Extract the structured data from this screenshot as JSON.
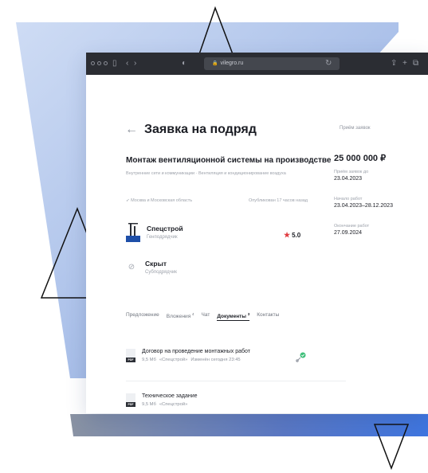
{
  "browser": {
    "url": "vilegro.ru"
  },
  "page": {
    "title": "Заявка на подряд",
    "status_badge": "Приём заявок",
    "job_title": "Монтаж вентиляционной системы на производстве",
    "breadcrumbs": "Внутренние сети и коммуникации · Вентиляция и кондиционирование воздуха",
    "region": "Москва и Московская область",
    "published": "Опубликован 17 часов назад"
  },
  "contractor": {
    "name": "Спецстрой",
    "role": "Генподрядчик",
    "rating": "5.0"
  },
  "subcontractor": {
    "name": "Скрыт",
    "role": "Субподрядчик"
  },
  "tabs": [
    {
      "label": "Предложение",
      "count": ""
    },
    {
      "label": "Вложения",
      "count": "4"
    },
    {
      "label": "Чат",
      "count": ""
    },
    {
      "label": "Документы",
      "count": "3"
    },
    {
      "label": "Контакты",
      "count": ""
    }
  ],
  "documents": [
    {
      "name": "Договор на проведение монтажных работ",
      "size": "9,5 Мб",
      "owner": "«Спецстрой»",
      "modified": "Изменён сегодня 23:45",
      "type": "PDF"
    },
    {
      "name": "Техническое задание",
      "size": "9,5 Мб",
      "owner": "«Спецстрой»",
      "modified": "",
      "type": "PDF"
    }
  ],
  "sidebar": {
    "price": "25 000 000 ₽",
    "deadline_label": "Приём заявок до",
    "deadline_value": "23.04.2023",
    "start_label": "Начало работ",
    "start_value": "23.04.2023–28.12.2023",
    "end_label": "Окончание работ",
    "end_value": "27.09.2024"
  },
  "colors": {
    "accent_star": "#e03b40",
    "sign_badge": "#3fbf7a",
    "bg_gradient_blue": "#a8c0ec",
    "window_dark": "#2b2d33"
  }
}
